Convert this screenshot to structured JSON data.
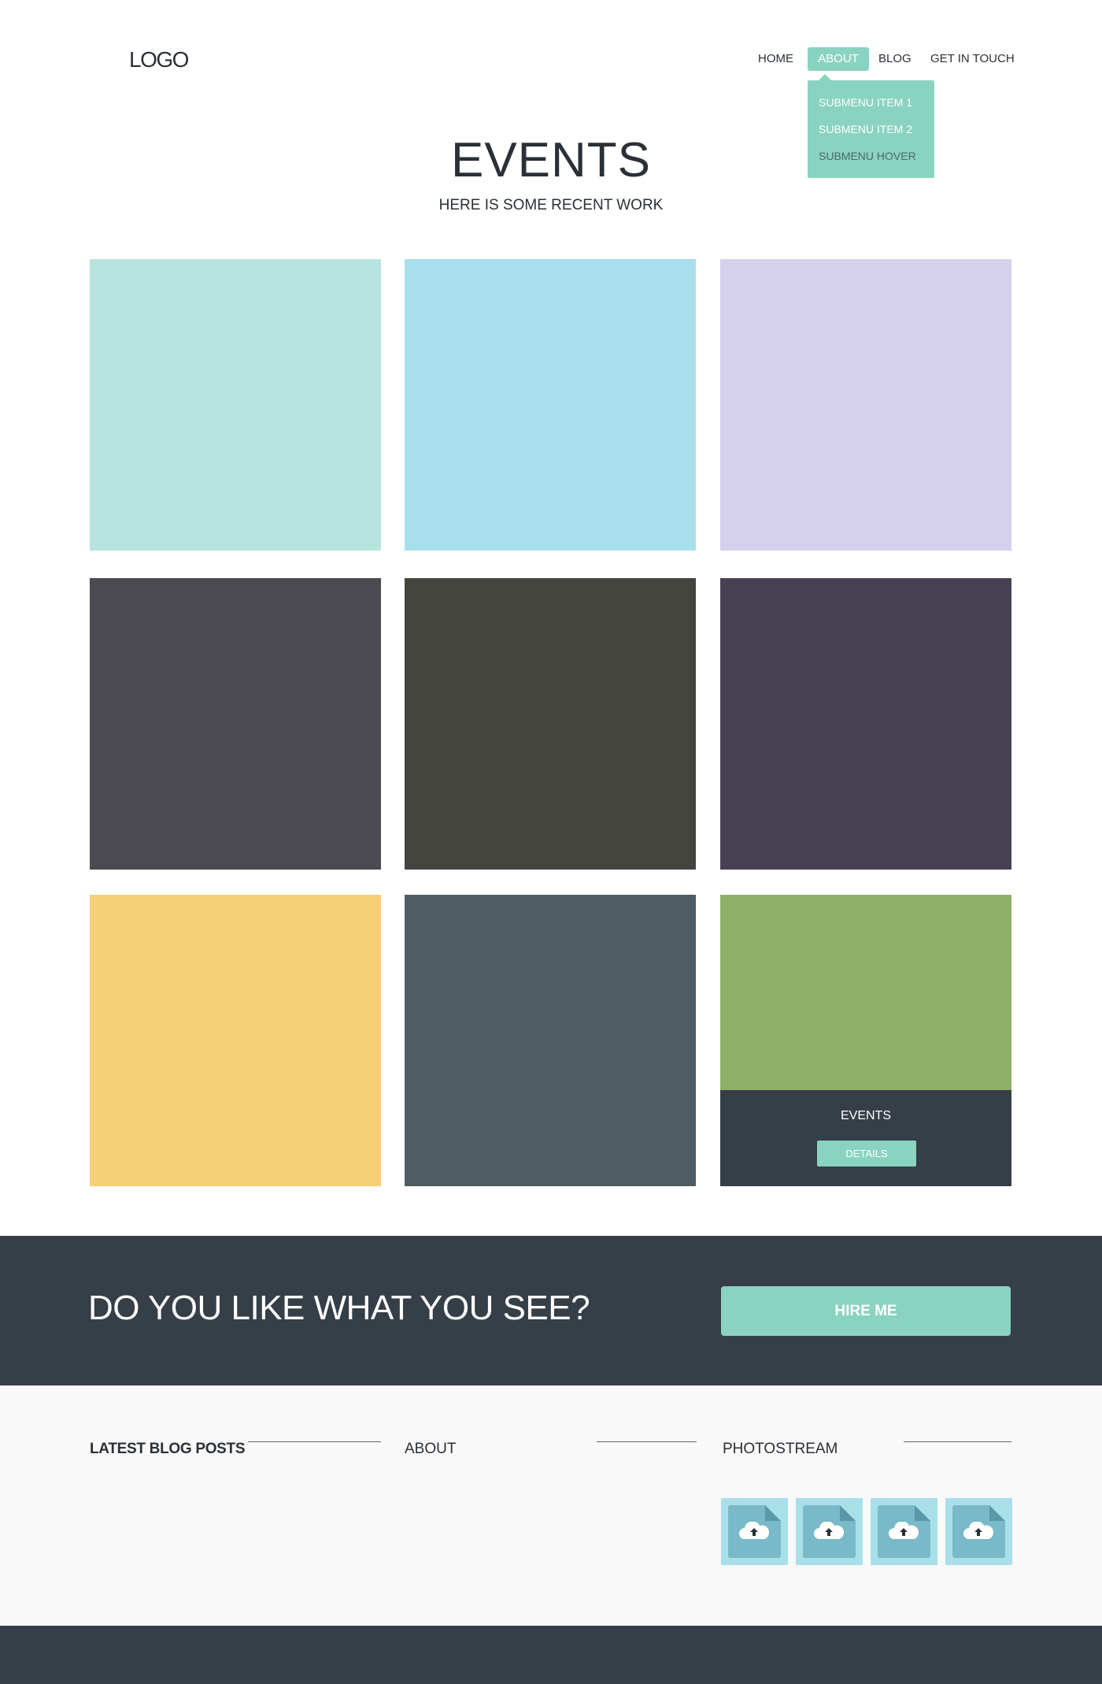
{
  "header": {
    "logo": "LOGO",
    "nav": [
      "HOME",
      "ABOUT",
      "BLOG",
      "GET IN TOUCH"
    ],
    "active_nav": "ABOUT",
    "submenu": [
      "SUBMENU ITEM 1",
      "SUBMENU ITEM 2",
      "SUBMENU HOVER"
    ]
  },
  "hero": {
    "title": "EVENTS",
    "subtitle": "HERE IS SOME RECENT WORK"
  },
  "portfolio": {
    "tile_colors": [
      "#b7e4de",
      "#a7dfec",
      "#d5d0ec",
      "#4a4a50",
      "#454540",
      "#474153",
      "#f5d077",
      "#4f5c62",
      "#8fb068"
    ],
    "hover_tile": {
      "label": "EVENTS",
      "button": "DETAILS"
    }
  },
  "cta": {
    "text": "DO YOU LIKE WHAT YOU SEE?",
    "button": "HIRE ME"
  },
  "footer": {
    "widgets": [
      "LATEST BLOG POSTS",
      "ABOUT",
      "PHOTOSTREAM"
    ],
    "photostream_icons": [
      "cloud-upload-icon",
      "cloud-upload-icon",
      "cloud-upload-icon",
      "cloud-upload-icon"
    ]
  },
  "colors": {
    "accent": "#8ad3c1",
    "dark": "#363e48",
    "footer_bg": "#f9f9f9"
  }
}
